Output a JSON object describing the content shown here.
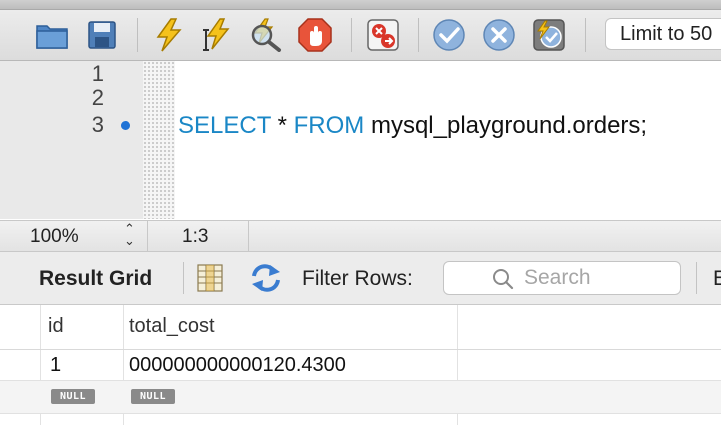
{
  "toolbar": {
    "limit_select": "Limit to 50"
  },
  "editor": {
    "line_numbers": [
      "1",
      "2",
      "3"
    ],
    "query": {
      "kw_select": "SELECT",
      "star": " * ",
      "kw_from": "FROM",
      "table": " mysql_playground.orders;"
    }
  },
  "status": {
    "zoom": "100%",
    "cursor_position": "1:3"
  },
  "results": {
    "tab_label": "Result Grid",
    "filter_label": "Filter Rows:",
    "search_placeholder": "Search",
    "extra_label": "E",
    "columns": [
      "id",
      "total_cost"
    ],
    "rows": [
      [
        "1",
        "000000000000120.4300"
      ],
      [
        "NULL",
        "NULL"
      ]
    ]
  },
  "colors": {
    "keyword": "#1a87c6",
    "breakpoint": "#1f73d6",
    "null_badge": "#8a8a8a"
  },
  "icons": [
    "folder-icon",
    "save-icon",
    "execute-icon",
    "execute-current-icon",
    "explain-icon",
    "stop-icon",
    "toggle-error-icon",
    "commit-icon",
    "rollback-icon",
    "autocommit-icon",
    "grid-view-icon",
    "refresh-icon",
    "search-icon"
  ]
}
